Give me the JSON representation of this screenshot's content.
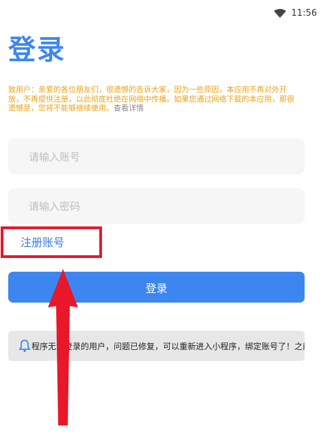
{
  "status_bar": {
    "time": "11:56",
    "wifi_icon": "wifi-icon"
  },
  "page": {
    "title": "登录"
  },
  "notice": {
    "text": "致用户：亲爱的各位朋友们，很遗憾的告诉大家，因为一些原因，本应用不再对外开放，不再提供注册，以此彻底杜绝在网络中传播。如果您通过网络下载的本应用，那很遗憾是，您将不能够继续使用。",
    "link": "查看详情"
  },
  "form": {
    "account_placeholder": "请输入账号",
    "password_placeholder": "请输入密码",
    "register_label": "注册账号",
    "login_label": "登录"
  },
  "announcement": {
    "icon": "bell-icon",
    "text": "程序无法登录的用户，问题已修复，可以重新进入小程序，绑定账号了！之前"
  },
  "colors": {
    "accent": "#3d86f0",
    "notice": "#e8a31c",
    "annotation": "#e8172a"
  }
}
